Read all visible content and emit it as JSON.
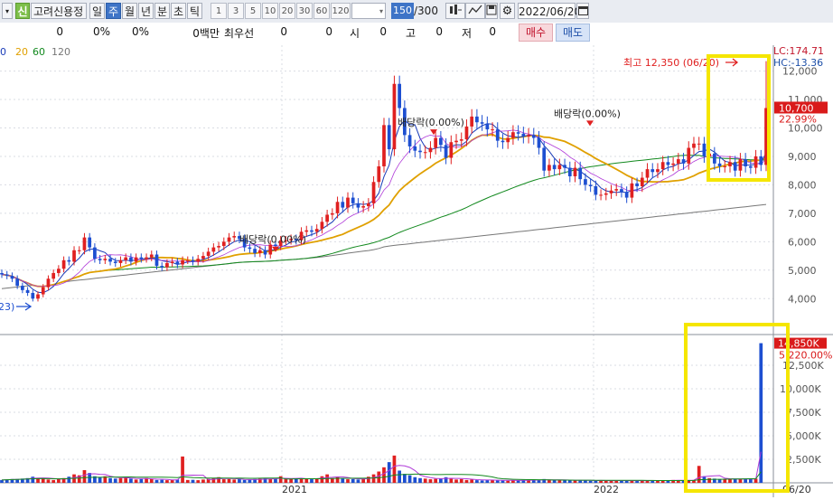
{
  "toolbar": {
    "stock_tag": "신",
    "stock_name": "고려신용정",
    "period_buttons": [
      "일",
      "주",
      "월",
      "년",
      "분",
      "초",
      "틱"
    ],
    "active_period": "주",
    "interval_buttons": [
      "1",
      "3",
      "5",
      "10",
      "20",
      "30",
      "60",
      "120"
    ],
    "count_value": "150",
    "count_total": "/300",
    "date_value": "2022/06/20"
  },
  "status": {
    "values": [
      "0",
      "0%",
      "0%",
      "0백만",
      "최우선",
      "0",
      "0",
      "시",
      "0",
      "고",
      "0",
      "저",
      "0"
    ],
    "buy_label": "매수",
    "sell_label": "매도"
  },
  "legend": {
    "ma_periods": [
      "0",
      "20",
      "60",
      "120"
    ],
    "ma_colors": [
      "#1a3cb8",
      "#e0a000",
      "#12891e",
      "#777777"
    ]
  },
  "price_panel": {
    "lc_label": "LC:174.71",
    "hc_label": "HC:-13.36",
    "current_price_label": "10,700",
    "change_label": "22.99%",
    "high_annotation": "최고 12,350 (06/20)",
    "low_annotation": "23)",
    "dividend_labels": [
      "배당락(0.00%)",
      "배당락(0.00%)",
      "배당락(0.00%)"
    ],
    "axis_ticks": [
      "12,000",
      "11,000",
      "10,000",
      "9,000",
      "8,000",
      "7,000",
      "6,000",
      "5,000",
      "4,000"
    ]
  },
  "volume_panel": {
    "max_label": "14,850K",
    "change_label": "5,220.00%",
    "axis_ticks": [
      "12,500K",
      "10,000K",
      "7,500K",
      "5,000K",
      "2,500K"
    ]
  },
  "x_axis": {
    "labels": [
      "2021",
      "2022",
      "06/20"
    ]
  },
  "colors": {
    "up": "#e02020",
    "down": "#1d4fd1",
    "highlight_box": "#f5e600",
    "ma5": "#1a3cb8",
    "ma20": "#e0a000",
    "ma60": "#12891e",
    "ma120": "#777777"
  },
  "chart_data": {
    "type": "candlestick",
    "title": "",
    "xlabel": "",
    "ylabel": "",
    "ylim": [
      3500,
      12400
    ],
    "volume_ylim": [
      0,
      15000
    ],
    "x": [
      0,
      1,
      2,
      3,
      4,
      5,
      6,
      7,
      8,
      9,
      10,
      11,
      12,
      13,
      14,
      15,
      16,
      17,
      18,
      19,
      20,
      21,
      22,
      23,
      24,
      25,
      26,
      27,
      28,
      29,
      30,
      31,
      32,
      33,
      34,
      35,
      36,
      37,
      38,
      39,
      40,
      41,
      42,
      43,
      44,
      45,
      46,
      47,
      48,
      49,
      50,
      51,
      52,
      53,
      54,
      55,
      56,
      57,
      58,
      59,
      60,
      61,
      62,
      63,
      64,
      65,
      66,
      67,
      68,
      69,
      70,
      71,
      72,
      73,
      74,
      75,
      76,
      77,
      78,
      79,
      80,
      81,
      82,
      83,
      84,
      85,
      86,
      87,
      88,
      89,
      90,
      91,
      92,
      93,
      94,
      95,
      96,
      97,
      98,
      99,
      100,
      101,
      102,
      103,
      104,
      105,
      106,
      107,
      108,
      109,
      110,
      111,
      112,
      113,
      114,
      115,
      116,
      117,
      118,
      119,
      120,
      121,
      122,
      123,
      124,
      125,
      126,
      127,
      128,
      129,
      130,
      131,
      132,
      133,
      134,
      135,
      136,
      137,
      138,
      139,
      140,
      141,
      142,
      143,
      144,
      145,
      146,
      147,
      148,
      149
    ],
    "close": [
      4850,
      4800,
      4700,
      4450,
      4300,
      4200,
      4000,
      4150,
      4400,
      4700,
      4900,
      5050,
      5350,
      5300,
      5700,
      5700,
      6150,
      5800,
      5400,
      5350,
      5400,
      5300,
      5250,
      5350,
      5450,
      5300,
      5450,
      5400,
      5450,
      5550,
      5150,
      5100,
      5250,
      5300,
      5200,
      5350,
      5350,
      5300,
      5400,
      5500,
      5650,
      5800,
      5850,
      6000,
      6150,
      6200,
      6100,
      5800,
      5750,
      5600,
      5700,
      5550,
      5900,
      5850,
      6050,
      6050,
      6100,
      6050,
      6350,
      6400,
      6350,
      6450,
      6700,
      6950,
      7000,
      7400,
      7200,
      7550,
      7350,
      7200,
      7250,
      7350,
      8100,
      8650,
      10100,
      9250,
      11550,
      10700,
      9750,
      9350,
      9200,
      9150,
      9150,
      9300,
      9650,
      9400,
      8950,
      9500,
      9550,
      9600,
      10050,
      10400,
      10200,
      10150,
      9950,
      9950,
      9550,
      9500,
      9650,
      9850,
      9800,
      9700,
      9750,
      9650,
      9300,
      8500,
      8700,
      8550,
      8700,
      8600,
      8300,
      8600,
      8200,
      8000,
      7950,
      7650,
      7650,
      7700,
      7800,
      7850,
      7750,
      7550,
      8050,
      7950,
      8250,
      8550,
      8450,
      8550,
      8800,
      8700,
      8750,
      8900,
      8750,
      9300,
      9450,
      9450,
      9000,
      9100,
      8750,
      8650,
      8650,
      8800,
      8500,
      8900,
      8650,
      8600,
      9000,
      8700,
      10700
    ],
    "volume": [
      300,
      350,
      400,
      400,
      450,
      500,
      650,
      520,
      500,
      350,
      300,
      400,
      500,
      650,
      900,
      800,
      1350,
      1050,
      700,
      600,
      700,
      500,
      450,
      500,
      600,
      450,
      350,
      400,
      500,
      400,
      300,
      320,
      280,
      300,
      350,
      2800,
      300,
      320,
      280,
      350,
      420,
      500,
      600,
      380,
      400,
      350,
      380,
      300,
      320,
      400,
      450,
      500,
      400,
      420,
      700,
      380,
      400,
      450,
      500,
      420,
      380,
      450,
      700,
      900,
      500,
      600,
      450,
      380,
      400,
      350,
      500,
      650,
      900,
      1200,
      1650,
      2200,
      2900,
      1300,
      950,
      800,
      600,
      500,
      450,
      380,
      420,
      480,
      600,
      500,
      350,
      400,
      300,
      350,
      280,
      250,
      300,
      320,
      260,
      240,
      220,
      250,
      280,
      300,
      320,
      280,
      260,
      400,
      350,
      300,
      280,
      250,
      260,
      240,
      300,
      260,
      220,
      200,
      260,
      240,
      230,
      250,
      240,
      220,
      210,
      230,
      250,
      260,
      240,
      220,
      230,
      250,
      300,
      280,
      260,
      250,
      300,
      1800,
      700,
      500,
      450,
      400,
      380,
      420,
      400,
      420,
      380,
      400,
      450,
      14850
    ]
  }
}
